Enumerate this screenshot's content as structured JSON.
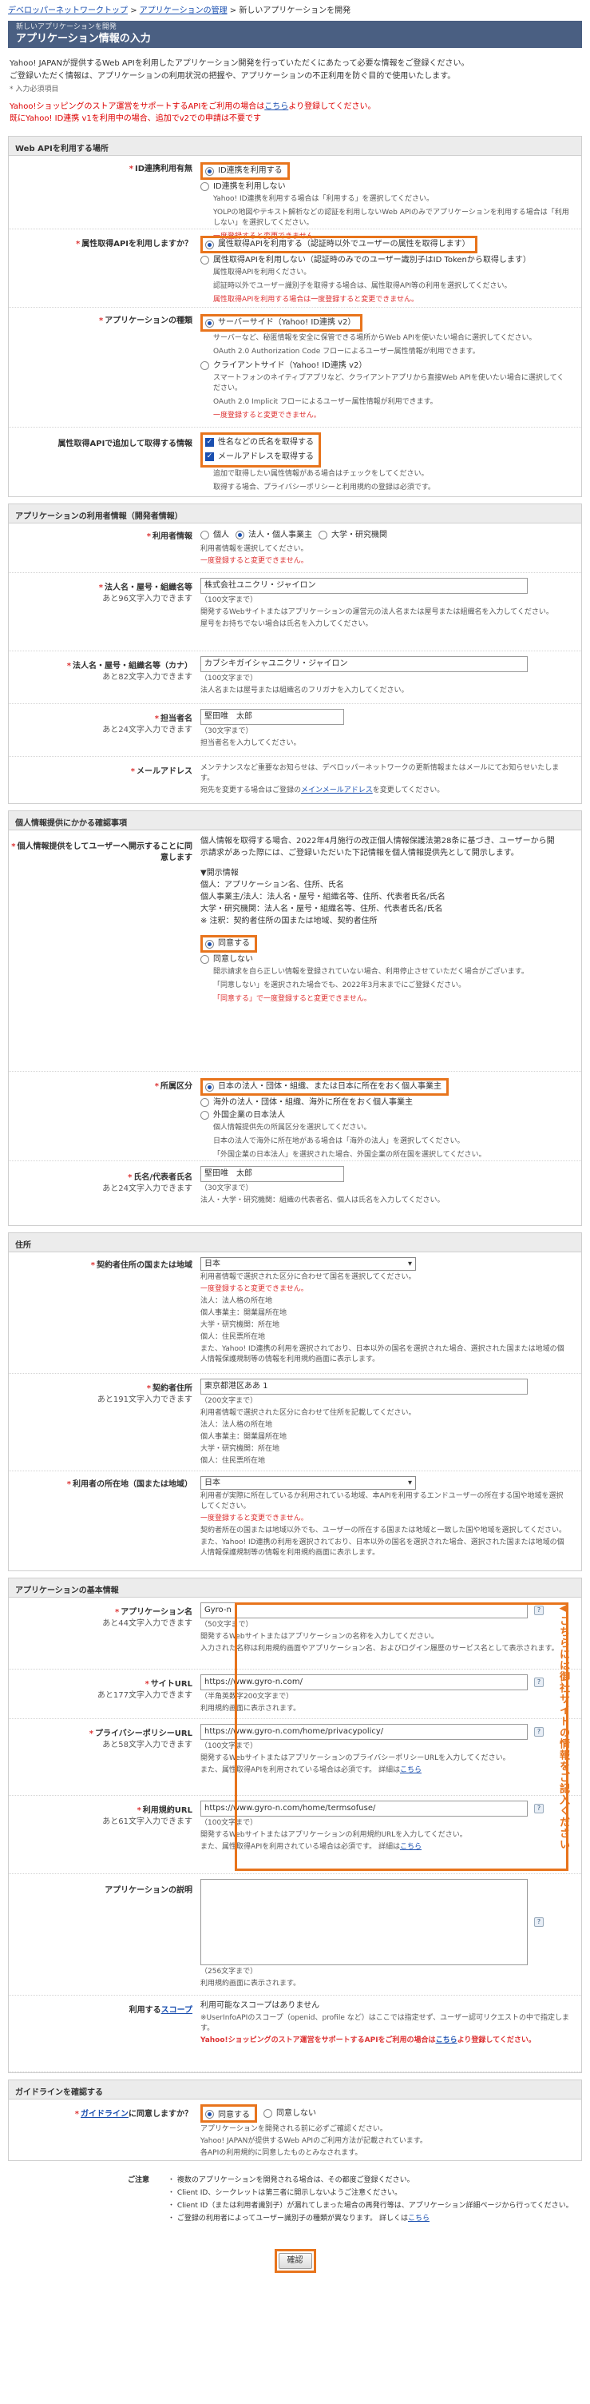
{
  "breadcrumb": {
    "items": [
      "デベロッパーネットワークトップ",
      "アプリケーションの管理",
      "新しいアプリケーションを開発"
    ],
    "sep": ">"
  },
  "header": {
    "subtitle": "新しいアプリケーションを開発",
    "title": "アプリケーション情報の入力"
  },
  "intro": {
    "lines": [
      "Yahoo! JAPANが提供するWeb APIを利用したアプリケーション開発を行っていただくにあたって必要な情報をご登録ください。",
      "ご登録いただく情報は、アプリケーションの利用状況の把握や、アプリケーションの不正利用を防ぐ目的で使用いたします。"
    ],
    "required_note": "* 入力必須項目",
    "warn1_pre": "Yahoo!ショッピングのストア運営をサポートするAPIをご利用の場合は",
    "warn1_link": "こちら",
    "warn1_post": "より登録してください。",
    "warn2": "既にYahoo! ID連携 v1を利用中の場合、追加でv2での申請は不要です"
  },
  "sec_webapi": {
    "head": "Web APIを利用する場所",
    "id_link": {
      "label": "ID連携利用有無",
      "opt_on": "ID連携を利用する",
      "opt_off": "ID連携を利用しない",
      "desc_on": "Yahoo! ID連携を利用する場合は「利用する」を選択してください。",
      "desc_off": "YOLPの地図やテキスト解析などの認証を利用しないWeb APIのみでアプリケーションを利用する場合は「利用しない」を選択してください。",
      "warn": "一度登録すると変更できません。"
    },
    "attr_api": {
      "label": "属性取得APIを利用しますか？",
      "opt_yes": "属性取得APIを利用する（認証時以外でユーザーの属性を取得します）",
      "opt_no": "属性取得APIを利用しない（認証時のみでのユーザー識別子はID Tokenから取得します）",
      "desc1": "属性取得APIを利用ください。",
      "desc2": "認証時以外でユーザー識別子を取得する場合は、属性取得API等の利用を選択してください。",
      "warn": "属性取得APIを利用する場合は一度登録すると変更できません。"
    },
    "app_type": {
      "label": "アプリケーションの種類",
      "opt_server": "サーバーサイド（Yahoo! ID連携 v2）",
      "desc_server1": "サーバーなど、秘匿情報を安全に保管できる場所からWeb APIを使いたい場合に選択してください。",
      "desc_server2": "OAuth 2.0 Authorization Code フローによるユーザー属性情報が利用できます。",
      "opt_client": "クライアントサイド（Yahoo! ID連携 v2）",
      "desc_client1": "スマートフォンのネイティブアプリなど、クライアントアプリから直接Web APIを使いたい場合に選択してください。",
      "desc_client2": "OAuth 2.0 Implicit フローによるユーザー属性情報が利用できます。",
      "warn": "一度登録すると変更できません。"
    },
    "scopes": {
      "label": "属性取得APIで追加して取得する情報",
      "opt_name": "性名などの氏名を取得する",
      "opt_email": "メールアドレスを取得する",
      "desc1": "追加で取得したい属性情報がある場合はチェックをしてください。",
      "desc2": "取得する場合、プライバシーポリシーと利用規約の登録は必須です。"
    }
  },
  "sec_user": {
    "head": "アプリケーションの利用者情報（開発者情報）",
    "user_type": {
      "label": "利用者情報",
      "opt_individual": "個人",
      "opt_corp": "法人・個人事業主",
      "opt_univ": "大学・研究機関",
      "note": "利用者情報を選択してください。",
      "warn": "一度登録すると変更できません。"
    },
    "corp_name": {
      "label": "法人名・屋号・組織名等",
      "sub": "あと96文字入力できます",
      "value": "株式会社ユニクリ・ジャイロン",
      "note1": "（100文字まで）",
      "note2": "開発するWebサイトまたはアプリケーションの運営元の法人名または屋号または組織名を入力してください。",
      "note3": "屋号をお持ちでない場合は氏名を入力してください。"
    },
    "corp_kana": {
      "label": "法人名・屋号・組織名等（カナ）",
      "sub": "あと82文字入力できます",
      "value": "カブシキガイシャユニクリ・ジャイロン",
      "note1": "（100文字まで）",
      "note2": "法人名または屋号または組織名のフリガナを入力してください。"
    },
    "contact": {
      "label": "担当者名",
      "sub": "あと24文字入力できます",
      "value": "堅田唯　太郎",
      "note1": "（30文字まで）",
      "note2": "担当者名を入力してください。"
    },
    "email": {
      "label": "メールアドレス",
      "note1": "メンテナンスなど重要なお知らせは、デベロッパーネットワークの更新情報またはメールにてお知らせいたします。",
      "note2_pre": "宛先を変更する場合はご登録の",
      "note2_link": "メインメールアドレス",
      "note2_post": "を変更してください。"
    }
  },
  "sec_privacy": {
    "head": "個人情報提供にかかる確認事項",
    "consent": {
      "label": "個人情報提供をしてユーザーへ開示することに同意します",
      "text": "個人情報を取得する場合、2022年4月施行の改正個人情報保護法第28条に基づき、ユーザーから開示請求があった際には、ご登録いただいた下記情報を個人情報提供先として開示します。",
      "disclose_head": "▼開示情報",
      "disclose1": "個人：アプリケーション名、住所、氏名",
      "disclose2": "個人事業主/法人：法人名・屋号・組織名等、住所、代表者氏名/氏名",
      "disclose3": "大学・研究機関：法人名・屋号・組織名等、住所、代表者氏名/氏名",
      "disclose4": "※ 注釈：契約者住所の国または地域、契約者住所",
      "opt_agree": "同意する",
      "opt_disagree": "同意しない",
      "desc1": "開示請求を自ら正しい情報を登録されていない場合、利用停止させていただく場合がございます。",
      "desc2": "「同意しない」を選択された場合でも、2022年3月末までにご登録ください。",
      "warn": "「同意する」で一度登録すると変更できません。"
    },
    "residence": {
      "label": "所属区分",
      "opt_jp": "日本の法人・団体・組織、または日本に所在をおく個人事業主",
      "opt_foreign": "海外の法人・団体・組織、海外に所在をおく個人事業主",
      "opt_foreign2": "外国企業の日本法人",
      "desc1": "個人情報提供先の所属区分を選択してください。",
      "desc2": "日本の法人で海外に所在地がある場合は「海外の法人」を選択してください。",
      "desc3": "「外国企業の日本法人」を選択された場合、外国企業の所在国を選択してください。"
    },
    "rep_name": {
      "label": "氏名/代表者氏名",
      "sub": "あと24文字入力できます",
      "value": "堅田唯　太郎",
      "note1": "（30文字まで）",
      "note2": "法人・大学・研究機関：組織の代表者名、個人は氏名を入力してください。"
    }
  },
  "sec_address": {
    "head": "住所",
    "country": {
      "label": "契約者住所の国または地域",
      "value": "日本",
      "note1": "利用者情報で選択された区分に合わせて国名を選択してください。",
      "warn": "一度登録すると変更できません。",
      "note2": "法人：法人格の所在地",
      "note3": "個人事業主：開業届所在地",
      "note4": "大学・研究機関：所在地",
      "note5": "個人：住民票所在地",
      "note6": "また、Yahoo! ID連携の利用を選択されており、日本以外の国名を選択された場合、選択された国または地域の個人情報保護規制等の情報を利用規約画面に表示します。"
    },
    "address": {
      "label": "契約者住所",
      "sub": "あと191文字入力できます",
      "value": "東京都港区ああ 1",
      "note1": "（200文字まで）",
      "note2": "利用者情報で選択された区分に合わせて住所を記載してください。",
      "note3": "法人：法人格の所在地",
      "note4": "個人事業主：開業届所在地",
      "note5": "大学・研究機関：所在地",
      "note6": "個人：住民票所在地"
    },
    "user_country": {
      "label": "利用者の所在地（国または地域）",
      "value": "日本",
      "note1": "利用者が実際に所在しているか利用されている地域、本APIを利用するエンドユーザーの所在する国や地域を選択してください。",
      "warn": "一度登録すると変更できません。",
      "note2": "契約者所在の国または地域以外でも、ユーザーの所在する国または地域と一致した国や地域を選択してください。",
      "note3": "また、Yahoo! ID連携の利用を選択されており、日本以外の国名を選択された場合、選択された国または地域の個人情報保護規制等の情報を利用規約画面に表示します。"
    }
  },
  "sec_basic": {
    "head": "アプリケーションの基本情報",
    "app_name": {
      "label": "アプリケーション名",
      "sub": "あと44文字入力できます",
      "value": "Gyro-n",
      "note1": "（50文字まで）",
      "note2": "開発するWebサイトまたはアプリケーションの名称を入力してください。",
      "note3": "入力された名称は利用規約画面やアプリケーション名、およびログイン履歴のサービス名として表示されます。"
    },
    "site_url": {
      "label": "サイトURL",
      "sub": "あと177文字入力できます",
      "value": "https://www.gyro-n.com/",
      "note1": "（半角英数字200文字まで）",
      "note2": "利用規約画面に表示されます。"
    },
    "privacy_url": {
      "label": "プライバシーポリシーURL",
      "sub": "あと58文字入力できます",
      "value": "https://www.gyro-n.com/home/privacypolicy/",
      "note1": "（100文字まで）",
      "note2": "開発するWebサイトまたはアプリケーションのプライバシーポリシーURLを入力してください。",
      "note3": "また、属性取得APIを利用されている場合は必須です。",
      "note4_pre": "詳細は",
      "note4_link": "こちら"
    },
    "terms_url": {
      "label": "利用規約URL",
      "sub": "あと61文字入力できます",
      "value": "https://www.gyro-n.com/home/termsofuse/",
      "note1": "（100文字まで）",
      "note2": "開発するWebサイトまたはアプリケーションの利用規約URLを入力してください。",
      "note3": "また、属性取得APIを利用されている場合は必須です。",
      "note4_pre": "詳細は",
      "note4_link": "こちら"
    },
    "app_desc": {
      "label": "アプリケーションの説明",
      "note1": "（256文字まで）",
      "note2": "利用規約画面に表示されます。"
    },
    "scope": {
      "label_pre": "利用する",
      "label_link": "スコープ",
      "value": "利用可能なスコープはありません",
      "note1": "※UserInfoAPIのスコープ（openid、profile など）はここでは指定せず、ユーザー認可リクエストの中で指定します。",
      "warn_pre": "Yahoo!ショッピングのストア運営をサポートするAPIをご利用の場合は",
      "warn_link": "こちら",
      "warn_post": "より登録してください。"
    },
    "side_label": "◀こちらには御社サイトの情報をご記入ください",
    "help": "?"
  },
  "sec_guideline": {
    "head": "ガイドラインを確認する",
    "label_link": "ガイドライン",
    "label_post": "に同意しますか？",
    "opt_agree": "同意する",
    "opt_disagree": "同意しない",
    "note1": "アプリケーションを開発される前に必ずご確認ください。",
    "note2": "Yahoo! JAPANが提供するWeb APIのご利用方法が記載されています。",
    "note3": "各APIの利用規約に同意したものとみなされます。"
  },
  "footnotes": {
    "title": "ご注意",
    "lines": [
      "・ 複数のアプリケーションを開発される場合は、その都度ご登録ください。",
      "・ Client ID、シークレットは第三者に開示しないようご注意ください。",
      "・ Client ID（または利用者識別子）が漏れてしまった場合の再発行等は、アプリケーション詳細ページから行ってください。",
      "・ ご登録の利用者によってユーザー識別子の種類が異なります。"
    ],
    "last_pre": "詳しくは",
    "last_link": "こちら"
  },
  "confirm_label": "確認",
  "colors": {
    "accent": "#e8741c",
    "header": "#4a5f82",
    "link": "#1a4fb0",
    "warn": "#dd3333"
  }
}
